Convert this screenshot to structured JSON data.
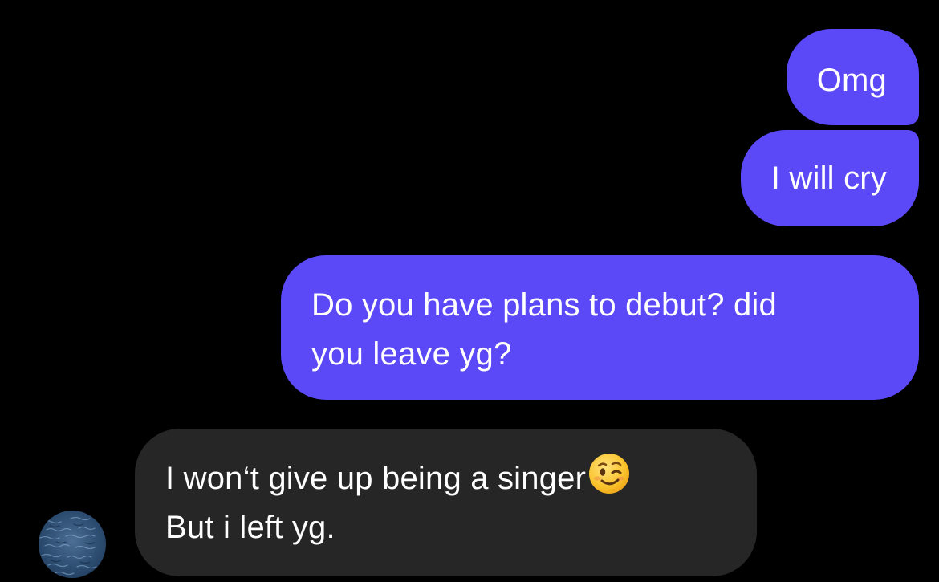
{
  "messages": {
    "sent": [
      {
        "lines": [
          "Omg"
        ]
      },
      {
        "lines": [
          "I will cry"
        ]
      },
      {
        "lines": [
          "Do you have plans to debut?  did",
          "you leave yg?"
        ]
      }
    ],
    "received": [
      {
        "lines": [
          "I won‘t give up being a singer",
          "But i left yg."
        ],
        "emoji_icon": "winking-face-icon"
      }
    ]
  },
  "avatar": {
    "icon": "ocean-water-avatar"
  },
  "colors": {
    "background": "#000000",
    "sent_bubble": "#5b48f7",
    "received_bubble": "#262626",
    "text": "#ffffff"
  }
}
